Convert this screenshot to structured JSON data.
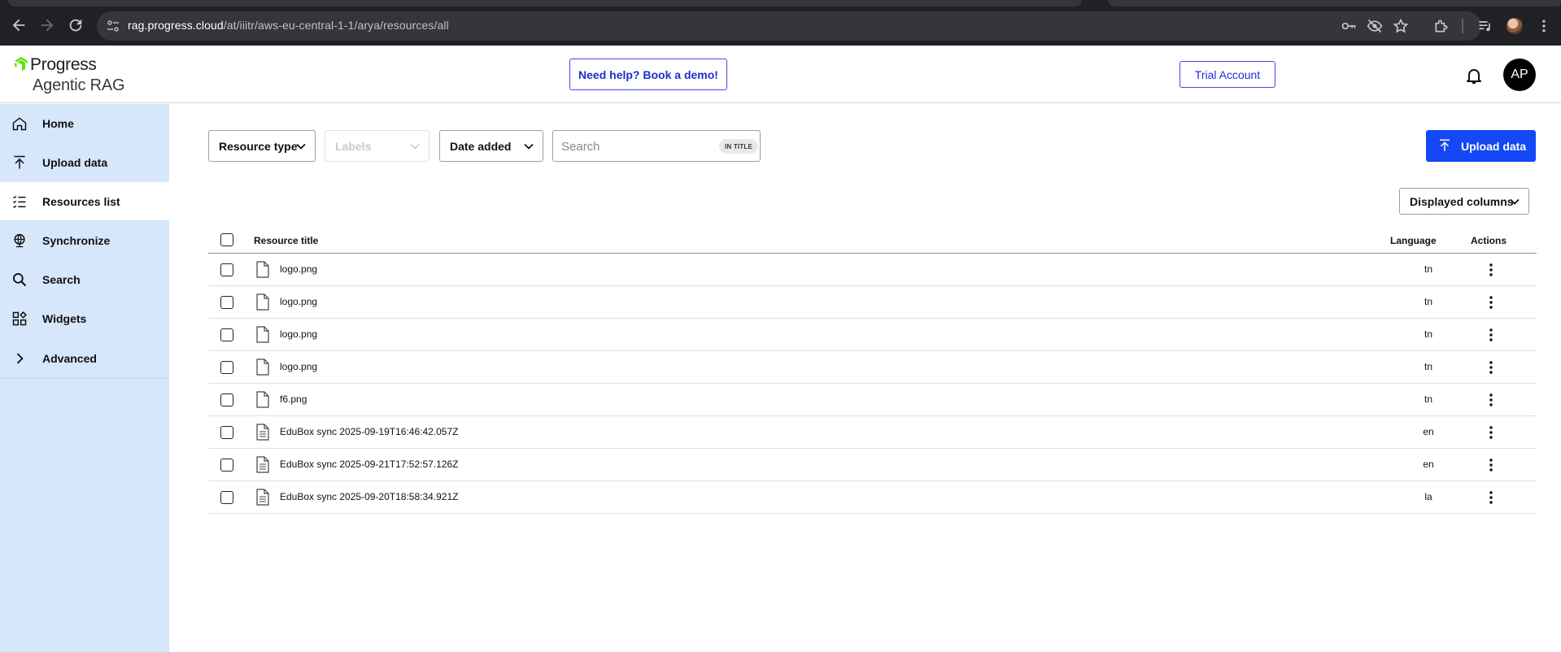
{
  "browser": {
    "url_host": "rag.progress.cloud",
    "url_path": "/at/iiitr/aws-eu-central-1-1/arya/resources/all",
    "icons": [
      "back-icon",
      "forward-icon",
      "reload-icon",
      "site-info-icon",
      "key-icon",
      "eye-off-icon",
      "star-icon",
      "extensions-icon",
      "media-icon",
      "profile-icon",
      "menu-icon"
    ]
  },
  "header": {
    "brand": "Progress",
    "product": "Agentic RAG",
    "help_button": "Need help? Book a demo!",
    "trial_button": "Trial Account",
    "avatar_initials": "AP"
  },
  "sidebar": {
    "items": [
      {
        "label": "Home",
        "icon": "home-icon"
      },
      {
        "label": "Upload data",
        "icon": "upload-icon"
      },
      {
        "label": "Resources list",
        "icon": "list-icon"
      },
      {
        "label": "Synchronize",
        "icon": "globe-icon"
      },
      {
        "label": "Search",
        "icon": "search-icon"
      },
      {
        "label": "Widgets",
        "icon": "widgets-icon"
      },
      {
        "label": "Advanced",
        "icon": "chevron-right-icon"
      }
    ],
    "active": "Resources list"
  },
  "filters": {
    "resource_type": "Resource type",
    "labels": "Labels",
    "date_added": "Date added",
    "search_placeholder": "Search",
    "search_scope": "IN TITLE"
  },
  "actions": {
    "upload": "Upload data",
    "displayed_columns": "Displayed columns"
  },
  "table": {
    "headers": {
      "title": "Resource title",
      "language": "Language",
      "actions": "Actions"
    },
    "rows": [
      {
        "title": "logo.png",
        "language": "tn",
        "icon": "file-icon"
      },
      {
        "title": "logo.png",
        "language": "tn",
        "icon": "file-icon"
      },
      {
        "title": "logo.png",
        "language": "tn",
        "icon": "file-icon"
      },
      {
        "title": "logo.png",
        "language": "tn",
        "icon": "file-icon"
      },
      {
        "title": "f6.png",
        "language": "tn",
        "icon": "file-icon"
      },
      {
        "title": "EduBox sync 2025-09-19T16:46:42.057Z",
        "language": "en",
        "icon": "text-file-icon"
      },
      {
        "title": "EduBox sync 2025-09-21T17:52:57.126Z",
        "language": "en",
        "icon": "text-file-icon"
      },
      {
        "title": "EduBox sync 2025-09-20T18:58:34.921Z",
        "language": "la",
        "icon": "text-file-icon"
      }
    ]
  },
  "colors": {
    "accent": "#1447f5",
    "sidebar_bg": "#d6e6fb",
    "brand_green": "#5ce500"
  }
}
